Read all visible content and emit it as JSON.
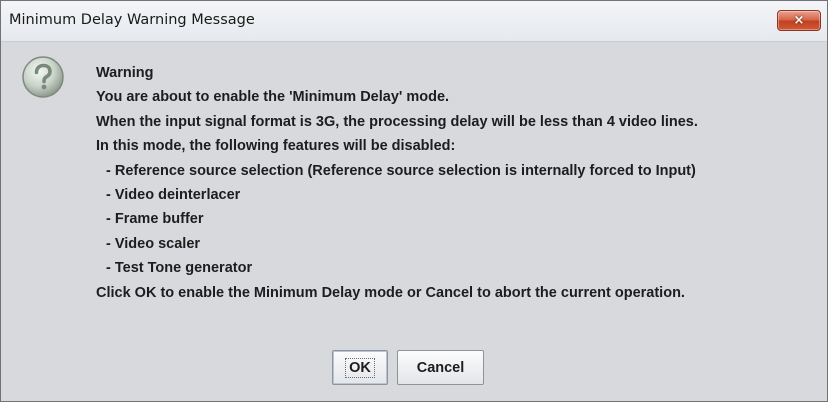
{
  "window": {
    "title": "Minimum Delay Warning Message",
    "close_label": "×"
  },
  "dialog": {
    "icon": "question-icon",
    "heading": "Warning",
    "lines": [
      "You are about to enable the 'Minimum Delay' mode.",
      "When the input signal format is 3G, the processing delay will be less than 4 video lines.",
      "In this mode, the following features will be disabled:",
      "- Reference source selection (Reference source selection is internally forced to Input)",
      "- Video deinterlacer",
      "- Frame buffer",
      "- Video scaler",
      "- Test Tone generator",
      "Click OK to enable the Minimum Delay mode or Cancel to abort the current operation."
    ]
  },
  "buttons": {
    "ok": "OK",
    "cancel": "Cancel"
  },
  "colors": {
    "close_button": "#c9492b",
    "background": "#d8d9dd"
  }
}
